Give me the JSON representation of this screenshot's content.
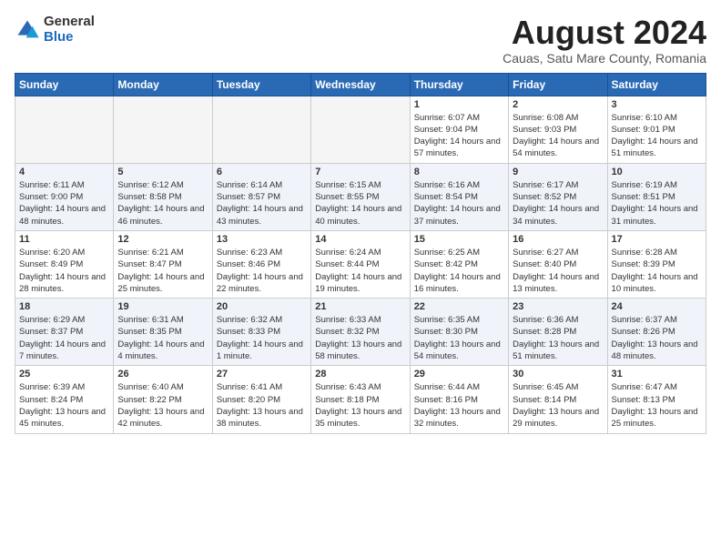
{
  "logo": {
    "general": "General",
    "blue": "Blue"
  },
  "title": "August 2024",
  "subtitle": "Cauas, Satu Mare County, Romania",
  "days_header": [
    "Sunday",
    "Monday",
    "Tuesday",
    "Wednesday",
    "Thursday",
    "Friday",
    "Saturday"
  ],
  "weeks": [
    [
      {
        "day": "",
        "info": ""
      },
      {
        "day": "",
        "info": ""
      },
      {
        "day": "",
        "info": ""
      },
      {
        "day": "",
        "info": ""
      },
      {
        "day": "1",
        "info": "Sunrise: 6:07 AM\nSunset: 9:04 PM\nDaylight: 14 hours and 57 minutes."
      },
      {
        "day": "2",
        "info": "Sunrise: 6:08 AM\nSunset: 9:03 PM\nDaylight: 14 hours and 54 minutes."
      },
      {
        "day": "3",
        "info": "Sunrise: 6:10 AM\nSunset: 9:01 PM\nDaylight: 14 hours and 51 minutes."
      }
    ],
    [
      {
        "day": "4",
        "info": "Sunrise: 6:11 AM\nSunset: 9:00 PM\nDaylight: 14 hours and 48 minutes."
      },
      {
        "day": "5",
        "info": "Sunrise: 6:12 AM\nSunset: 8:58 PM\nDaylight: 14 hours and 46 minutes."
      },
      {
        "day": "6",
        "info": "Sunrise: 6:14 AM\nSunset: 8:57 PM\nDaylight: 14 hours and 43 minutes."
      },
      {
        "day": "7",
        "info": "Sunrise: 6:15 AM\nSunset: 8:55 PM\nDaylight: 14 hours and 40 minutes."
      },
      {
        "day": "8",
        "info": "Sunrise: 6:16 AM\nSunset: 8:54 PM\nDaylight: 14 hours and 37 minutes."
      },
      {
        "day": "9",
        "info": "Sunrise: 6:17 AM\nSunset: 8:52 PM\nDaylight: 14 hours and 34 minutes."
      },
      {
        "day": "10",
        "info": "Sunrise: 6:19 AM\nSunset: 8:51 PM\nDaylight: 14 hours and 31 minutes."
      }
    ],
    [
      {
        "day": "11",
        "info": "Sunrise: 6:20 AM\nSunset: 8:49 PM\nDaylight: 14 hours and 28 minutes."
      },
      {
        "day": "12",
        "info": "Sunrise: 6:21 AM\nSunset: 8:47 PM\nDaylight: 14 hours and 25 minutes."
      },
      {
        "day": "13",
        "info": "Sunrise: 6:23 AM\nSunset: 8:46 PM\nDaylight: 14 hours and 22 minutes."
      },
      {
        "day": "14",
        "info": "Sunrise: 6:24 AM\nSunset: 8:44 PM\nDaylight: 14 hours and 19 minutes."
      },
      {
        "day": "15",
        "info": "Sunrise: 6:25 AM\nSunset: 8:42 PM\nDaylight: 14 hours and 16 minutes."
      },
      {
        "day": "16",
        "info": "Sunrise: 6:27 AM\nSunset: 8:40 PM\nDaylight: 14 hours and 13 minutes."
      },
      {
        "day": "17",
        "info": "Sunrise: 6:28 AM\nSunset: 8:39 PM\nDaylight: 14 hours and 10 minutes."
      }
    ],
    [
      {
        "day": "18",
        "info": "Sunrise: 6:29 AM\nSunset: 8:37 PM\nDaylight: 14 hours and 7 minutes."
      },
      {
        "day": "19",
        "info": "Sunrise: 6:31 AM\nSunset: 8:35 PM\nDaylight: 14 hours and 4 minutes."
      },
      {
        "day": "20",
        "info": "Sunrise: 6:32 AM\nSunset: 8:33 PM\nDaylight: 14 hours and 1 minute."
      },
      {
        "day": "21",
        "info": "Sunrise: 6:33 AM\nSunset: 8:32 PM\nDaylight: 13 hours and 58 minutes."
      },
      {
        "day": "22",
        "info": "Sunrise: 6:35 AM\nSunset: 8:30 PM\nDaylight: 13 hours and 54 minutes."
      },
      {
        "day": "23",
        "info": "Sunrise: 6:36 AM\nSunset: 8:28 PM\nDaylight: 13 hours and 51 minutes."
      },
      {
        "day": "24",
        "info": "Sunrise: 6:37 AM\nSunset: 8:26 PM\nDaylight: 13 hours and 48 minutes."
      }
    ],
    [
      {
        "day": "25",
        "info": "Sunrise: 6:39 AM\nSunset: 8:24 PM\nDaylight: 13 hours and 45 minutes."
      },
      {
        "day": "26",
        "info": "Sunrise: 6:40 AM\nSunset: 8:22 PM\nDaylight: 13 hours and 42 minutes."
      },
      {
        "day": "27",
        "info": "Sunrise: 6:41 AM\nSunset: 8:20 PM\nDaylight: 13 hours and 38 minutes."
      },
      {
        "day": "28",
        "info": "Sunrise: 6:43 AM\nSunset: 8:18 PM\nDaylight: 13 hours and 35 minutes."
      },
      {
        "day": "29",
        "info": "Sunrise: 6:44 AM\nSunset: 8:16 PM\nDaylight: 13 hours and 32 minutes."
      },
      {
        "day": "30",
        "info": "Sunrise: 6:45 AM\nSunset: 8:14 PM\nDaylight: 13 hours and 29 minutes."
      },
      {
        "day": "31",
        "info": "Sunrise: 6:47 AM\nSunset: 8:13 PM\nDaylight: 13 hours and 25 minutes."
      }
    ]
  ]
}
